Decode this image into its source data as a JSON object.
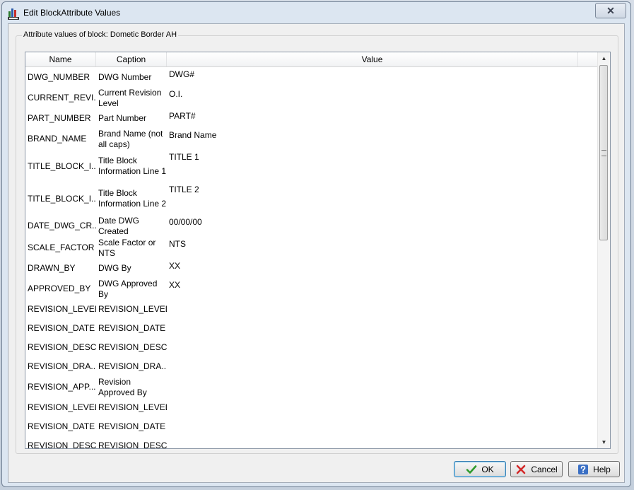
{
  "window": {
    "title": "Edit BlockAttribute Values",
    "close_glyph": "✕"
  },
  "group": {
    "label": "Attribute values of block: Dometic Border AH"
  },
  "table": {
    "headers": [
      "Name",
      "Caption",
      "Value"
    ],
    "rows": [
      {
        "name": "DWG_NUMBER",
        "caption": "DWG Number",
        "value": "DWG#"
      },
      {
        "name": "CURRENT_REVI...",
        "caption": "Current Revision Level",
        "value": "O.I."
      },
      {
        "name": "PART_NUMBER",
        "caption": "Part Number",
        "value": "PART#"
      },
      {
        "name": "BRAND_NAME",
        "caption": "Brand Name (not all caps)",
        "value": "Brand Name"
      },
      {
        "name": "TITLE_BLOCK_I...",
        "caption": "Title Block Information Line 1",
        "value": "TITLE 1"
      },
      {
        "name": "TITLE_BLOCK_I...",
        "caption": "Title Block Information Line 2",
        "value": "TITLE 2"
      },
      {
        "name": "DATE_DWG_CR...",
        "caption": "Date DWG Created",
        "value": "00/00/00"
      },
      {
        "name": "SCALE_FACTOR",
        "caption": "Scale Factor or NTS",
        "value": "NTS"
      },
      {
        "name": "DRAWN_BY",
        "caption": "DWG By",
        "value": "XX"
      },
      {
        "name": "APPROVED_BY",
        "caption": "DWG Approved By",
        "value": "XX"
      },
      {
        "name": "REVISION_LEVEL",
        "caption": "REVISION_LEVEL",
        "value": ""
      },
      {
        "name": "REVISION_DATE",
        "caption": "REVISION_DATE",
        "value": ""
      },
      {
        "name": "REVISION_DESC...",
        "caption": "REVISION_DESC...",
        "value": ""
      },
      {
        "name": "REVISION_DRA...",
        "caption": "REVISION_DRA...",
        "value": ""
      },
      {
        "name": "REVISION_APP...",
        "caption": "Revision Approved By",
        "value": ""
      },
      {
        "name": "REVISION_LEVEL",
        "caption": "REVISION_LEVEL",
        "value": ""
      },
      {
        "name": "REVISION_DATE",
        "caption": "REVISION_DATE",
        "value": ""
      },
      {
        "name": "REVISION_DESC...",
        "caption": "REVISION_DESC...",
        "value": ""
      }
    ]
  },
  "buttons": {
    "ok": "OK",
    "cancel": "Cancel",
    "help": "Help"
  },
  "colors": {
    "ok_check": "#2e9b2e",
    "cancel_x": "#d42a2a",
    "help_icon": "#3a6fc4"
  }
}
